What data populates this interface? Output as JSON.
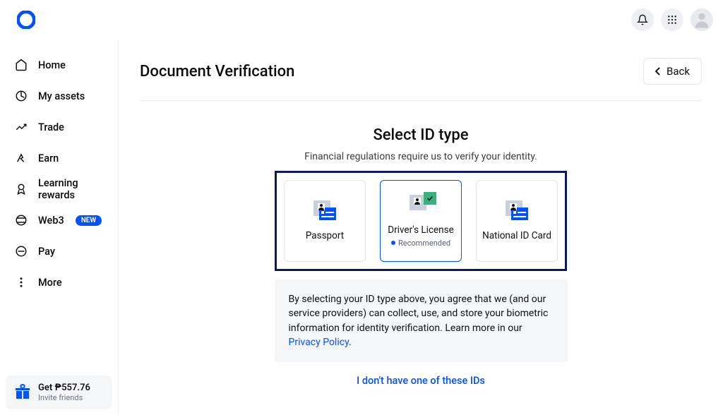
{
  "header": {
    "back_label": "Back"
  },
  "page": {
    "title": "Document Verification"
  },
  "sidebar": {
    "items": [
      {
        "label": "Home"
      },
      {
        "label": "My assets"
      },
      {
        "label": "Trade"
      },
      {
        "label": "Earn"
      },
      {
        "label": "Learning rewards"
      },
      {
        "label": "Web3",
        "badge": "NEW"
      },
      {
        "label": "Pay"
      },
      {
        "label": "More"
      }
    ],
    "invite": {
      "title": "Get ₱557.76",
      "subtitle": "Invite friends"
    }
  },
  "verify": {
    "heading": "Select ID type",
    "subheading": "Financial regulations require us to verify your identity.",
    "options": [
      {
        "label": "Passport"
      },
      {
        "label": "Driver's License",
        "recommended": "Recommended"
      },
      {
        "label": "National ID Card"
      }
    ],
    "disclosure_pre": "By selecting your ID type above, you agree that we (and our service providers) can collect, use, and store your biometric information for identity verification. Learn more in our ",
    "disclosure_link": "Privacy Policy",
    "disclosure_post": ".",
    "alt_link": "I don't have one of these IDs"
  }
}
